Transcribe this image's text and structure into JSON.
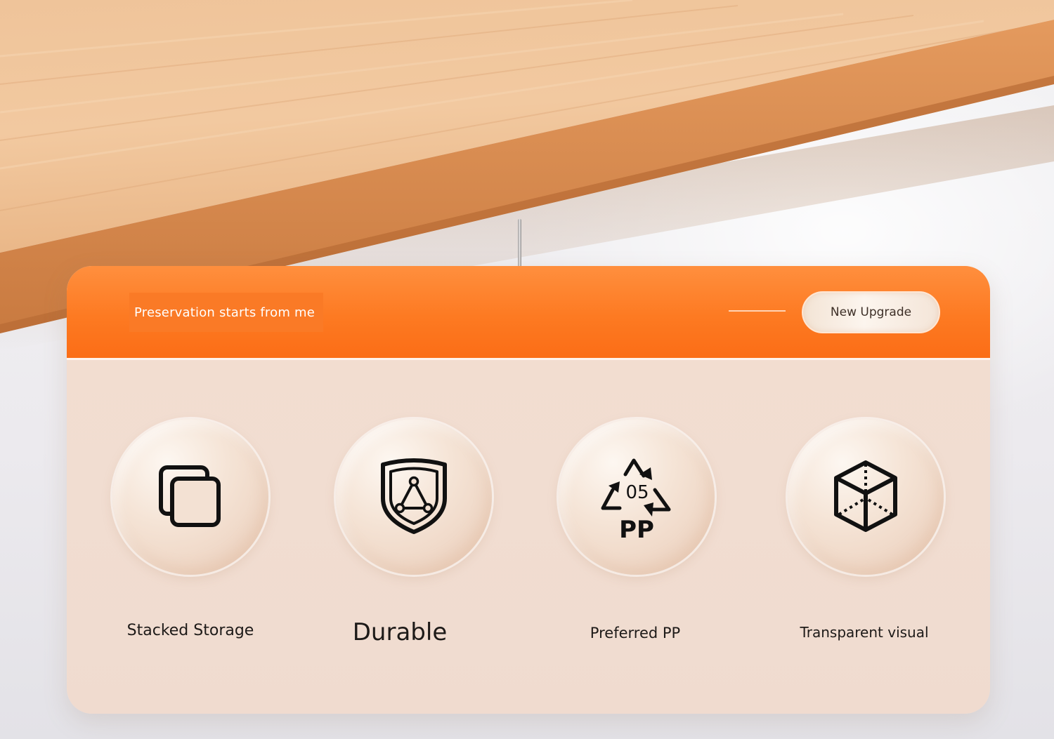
{
  "colors": {
    "header_orange": "#fd7a22",
    "card_background": "#f1ddd1",
    "pill_background": "#fcf5ee",
    "wood": "#e9b383"
  },
  "header": {
    "tagline": "Preservation starts from me",
    "badge_label": "New Upgrade"
  },
  "features": [
    {
      "label": "Stacked Storage",
      "icon": "stacked-squares-icon"
    },
    {
      "label": "Durable",
      "icon": "shield-icon"
    },
    {
      "label": "Preferred PP",
      "icon": "recycle-icon",
      "icon_text_top": "05",
      "icon_text_bottom": "PP"
    },
    {
      "label": "Transparent visual",
      "icon": "cube-icon"
    }
  ]
}
